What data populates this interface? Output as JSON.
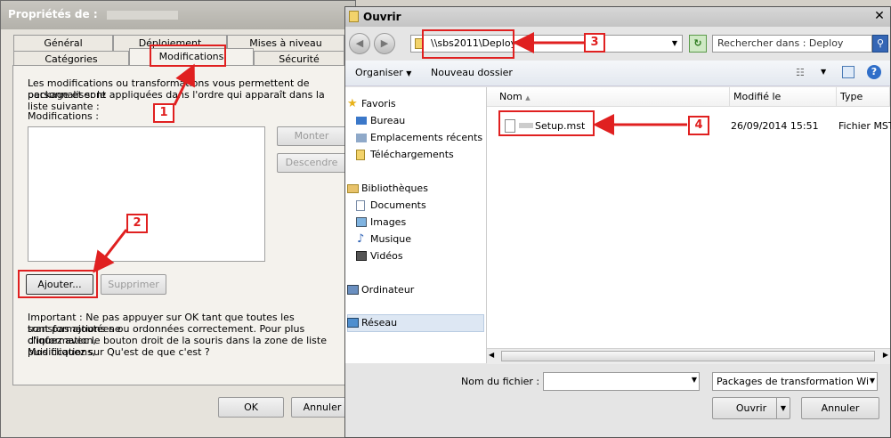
{
  "props": {
    "title": "Propriétés de :",
    "tabs_top": [
      "Général",
      "Déploiement",
      "Mises à niveau"
    ],
    "tabs_bottom": [
      "Catégories",
      "Modifications",
      "Sécurité"
    ],
    "description_l1": "Les modifications ou transformations vous permettent de personnaliser le",
    "description_l2": "package et sont appliquées dans l'ordre qui apparaît dans la liste suivante :",
    "modifications_label": "Modifications :",
    "btn_up": "Monter",
    "btn_down": "Descendre",
    "btn_add": "Ajouter...",
    "btn_remove": "Supprimer",
    "important_l1": "Important : Ne pas appuyer sur OK tant que toutes les transformations ne",
    "important_l2": "sont pas ajoutées ou ordonnées correctement. Pour plus d'information,",
    "important_l3": "cliquez avec le bouton droit de la souris dans la zone de liste Modifications,",
    "important_l4": "puis cliquez sur Qu'est de que c'est ?",
    "btn_ok": "OK",
    "btn_cancel": "Annuler"
  },
  "dialog": {
    "title": "Ouvrir",
    "address": "\\\\sbs2011\\Deploy",
    "search_placeholder": "Rechercher dans : Deploy",
    "organize": "Organiser",
    "new_folder": "Nouveau dossier",
    "nav": {
      "favorites": "Favoris",
      "desktop": "Bureau",
      "recent": "Emplacements récents",
      "downloads": "Téléchargements",
      "libraries": "Bibliothèques",
      "documents": "Documents",
      "images": "Images",
      "music": "Musique",
      "videos": "Vidéos",
      "computer": "Ordinateur",
      "network": "Réseau"
    },
    "columns": {
      "name": "Nom",
      "modified": "Modifié le",
      "type": "Type"
    },
    "file": {
      "name": "Setup.mst",
      "modified": "26/09/2014 15:51",
      "type": "Fichier MST"
    },
    "filename_label": "Nom du fichier :",
    "filetype": "Packages de transformation Wi",
    "btn_open": "Ouvrir",
    "btn_cancel": "Annuler"
  },
  "annotations": [
    "1",
    "2",
    "3",
    "4"
  ],
  "colors": {
    "annotation": "#e02020",
    "selection": "#cfe3f8",
    "nav_selected": "#dde7f3"
  }
}
